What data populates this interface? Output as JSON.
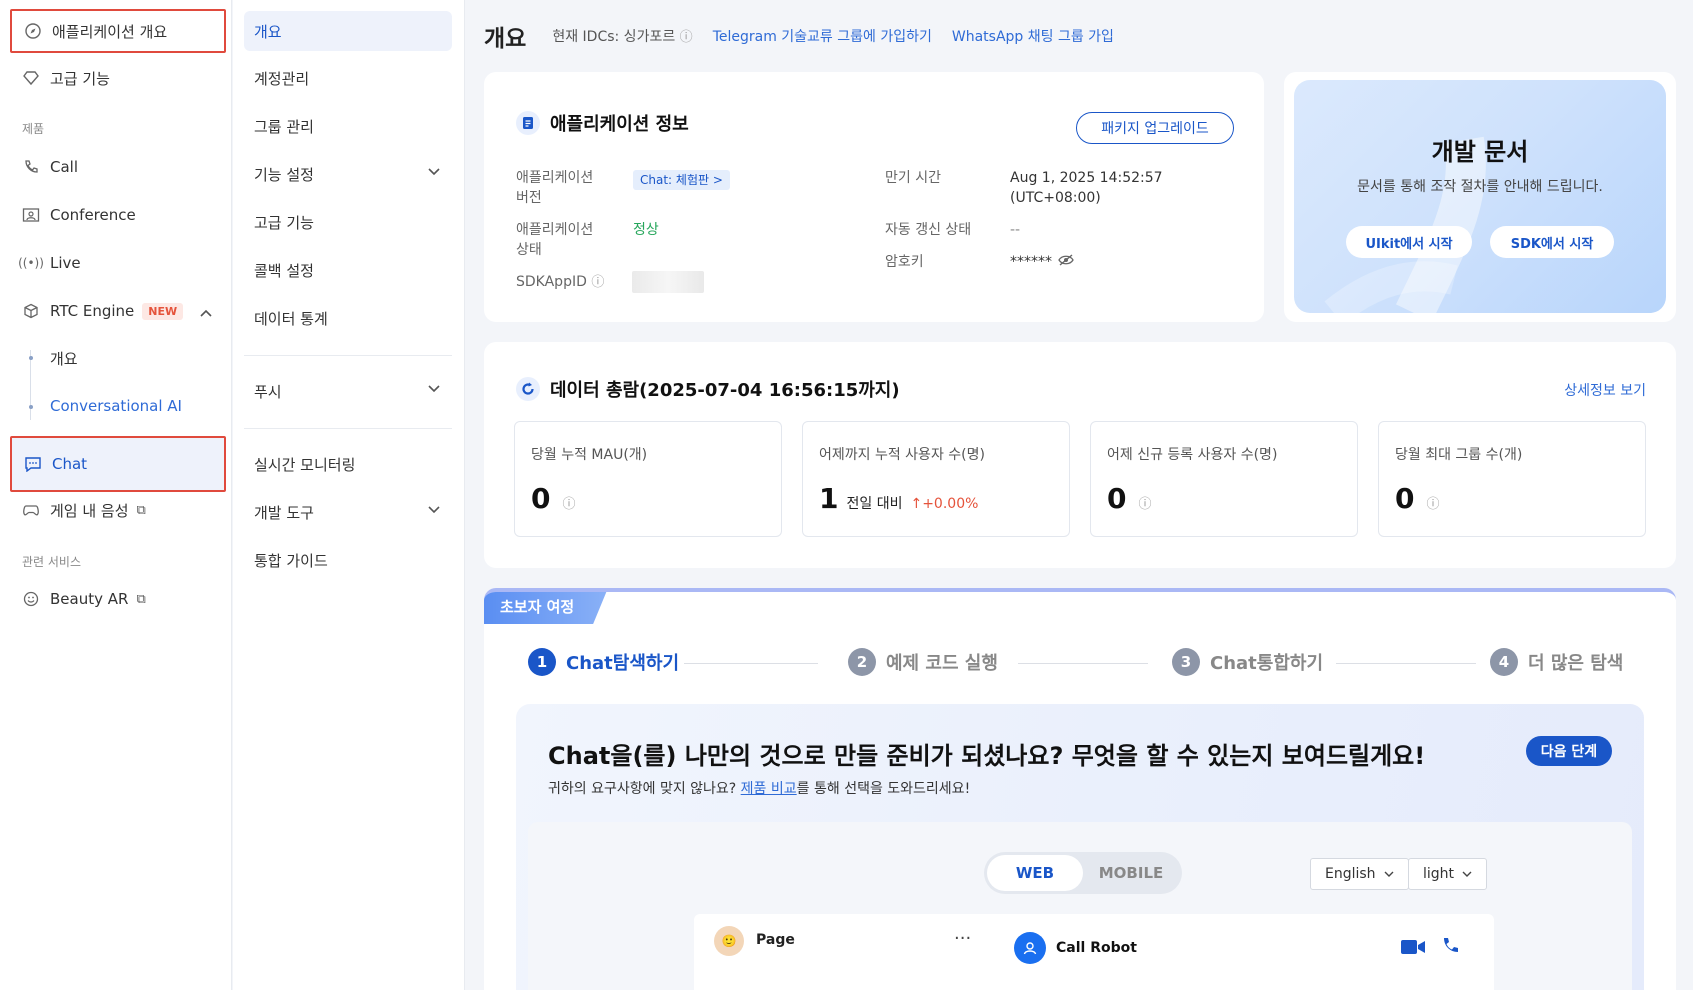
{
  "sidebar": {
    "items": [
      {
        "label": "애플리케이션 개요"
      },
      {
        "label": "고급 기능"
      },
      {
        "label": "Call"
      },
      {
        "label": "Conference"
      },
      {
        "label": "Live"
      },
      {
        "label": "RTC Engine",
        "badge": "NEW"
      },
      {
        "label": "Chat"
      },
      {
        "label": "게임 내 음성"
      },
      {
        "label": "Beauty AR"
      }
    ],
    "section_products": "제품",
    "section_related": "관련 서비스",
    "rtc_sub": [
      {
        "label": "개요"
      },
      {
        "label": "Conversational AI"
      }
    ]
  },
  "nav2": {
    "items": [
      {
        "label": "개요"
      },
      {
        "label": "계정관리"
      },
      {
        "label": "그룹 관리"
      },
      {
        "label": "기능 설정"
      },
      {
        "label": "고급 기능"
      },
      {
        "label": "콜백 설정"
      },
      {
        "label": "데이터 통계"
      },
      {
        "label": "푸시"
      },
      {
        "label": "실시간 모니터링"
      },
      {
        "label": "개발 도구"
      },
      {
        "label": "통합 가이드"
      }
    ]
  },
  "header": {
    "title": "개요",
    "idc": "현재 IDCs: 싱가포르",
    "link1": "Telegram 기술교류 그룹에 가입하기",
    "link2": "WhatsApp 채팅 그룹 가입"
  },
  "appinfo": {
    "title": "애플리케이션 정보",
    "upgrade": "패키지 업그레이드",
    "version_label_1": "애플리케이션",
    "version_label_2": "버전",
    "version_value": "Chat: 체험판 >",
    "status_label_1": "애플리케이션",
    "status_label_2": "상태",
    "status_value": "정상",
    "sdkappid_label": "SDKAppID",
    "expire_label": "만기 시간",
    "expire_value_1": "Aug 1, 2025 14:52:57",
    "expire_value_2": "(UTC+08:00)",
    "autorenew_label": "자동 갱신 상태",
    "autorenew_value": "--",
    "key_label": "암호키",
    "key_value": "******"
  },
  "docs": {
    "title": "개발 문서",
    "subtitle": "문서를 통해 조작 절차를 안내해 드립니다.",
    "btn1": "UIkit에서 시작",
    "btn2": "SDK에서 시작"
  },
  "overview": {
    "title": "데이터 총람(2025-07-04 16:56:15까지)",
    "detail_link": "상세정보 보기",
    "stats": [
      {
        "label": "당월 누적 MAU(개)",
        "value": "0"
      },
      {
        "label": "어제까지 누적 사용자 수(명)",
        "value": "1",
        "compare": "전일 대비",
        "change": "+0.00%"
      },
      {
        "label": "어제 신규 등록 사용자 수(명)",
        "value": "0"
      },
      {
        "label": "당월 최대 그룹 수(개)",
        "value": "0"
      }
    ]
  },
  "journey": {
    "tab": "초보자 여정",
    "steps": [
      {
        "num": "1",
        "label": "Chat탐색하기"
      },
      {
        "num": "2",
        "label": "예제 코드 실행"
      },
      {
        "num": "3",
        "label": "Chat통합하기"
      },
      {
        "num": "4",
        "label": "더 많은 탐색"
      }
    ],
    "headline": "Chat을(를) 나만의 것으로 만들 준비가 되셨나요? 무엇을 할 수 있는지 보여드릴게요!",
    "desc_pre": "귀하의 요구사항에 맞지 않나요? ",
    "desc_link": "제품 비교",
    "desc_post": "를 통해 선택을 도와드리세요!",
    "next": "다음 단계",
    "seg_web": "WEB",
    "seg_mobile": "MOBILE",
    "lang": "English",
    "theme": "light",
    "chat_page": "Page",
    "chat_more": "···",
    "call_robot": "Call Robot"
  },
  "colors": {
    "accent": "#1a56c8",
    "highlight_border": "#e04a3d",
    "new_badge": "#e5533b",
    "status_ok": "#26a65b"
  }
}
